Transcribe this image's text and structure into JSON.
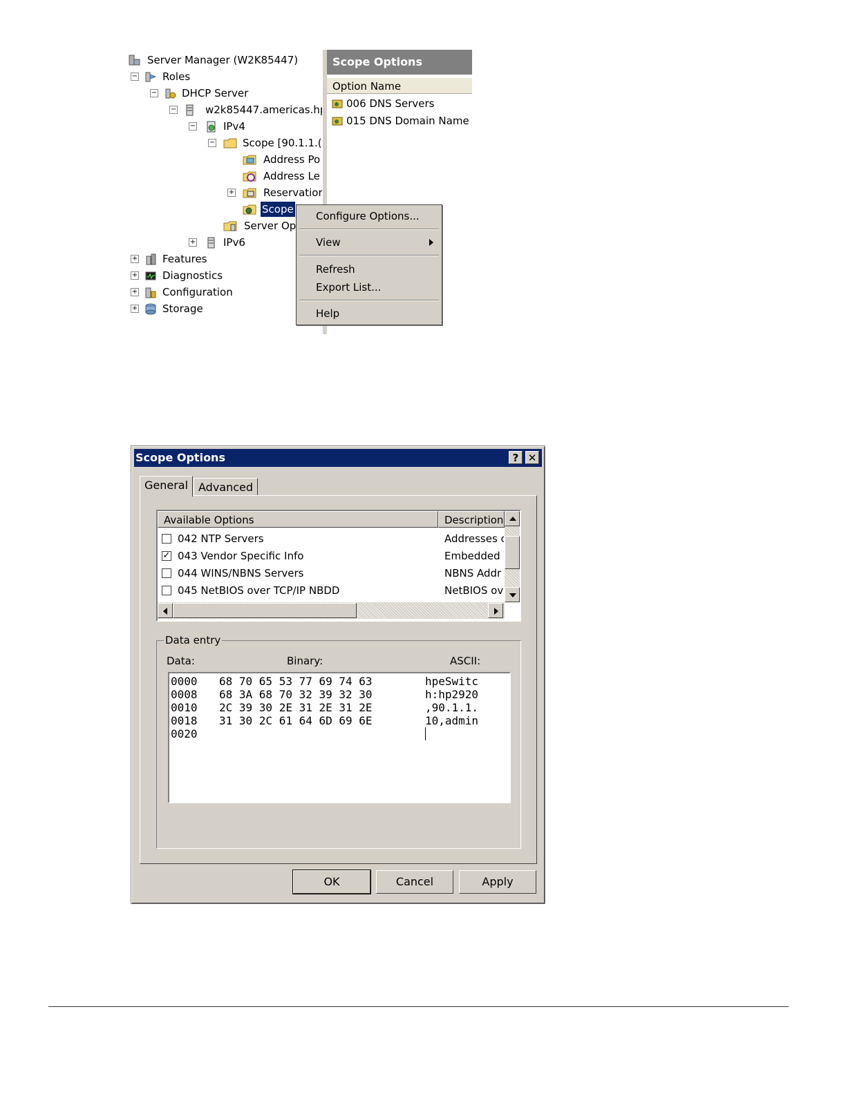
{
  "server_manager": {
    "tree": {
      "root": "Server Manager (W2K85447)",
      "roles": "Roles",
      "dhcp_server": "DHCP Server",
      "host": "w2k85447.americas.hp",
      "ipv4": "IPv4",
      "scope": "Scope [90.1.1.(",
      "address_pool": "Address Po",
      "address_leases": "Address Le",
      "reservations": "Reservatior",
      "scope_options": "Scope",
      "server_options": "Server Op",
      "ipv6": "IPv6",
      "features": "Features",
      "diagnostics": "Diagnostics",
      "configuration": "Configuration",
      "storage": "Storage",
      "expand_symbol": "+",
      "collapse_symbol": "−"
    },
    "right_pane": {
      "title": "Scope Options",
      "column_header": "Option Name",
      "items": [
        "006 DNS Servers",
        "015 DNS Domain Name"
      ]
    },
    "context_menu": {
      "items": {
        "configure": "Configure Options...",
        "view": "View",
        "refresh": "Refresh",
        "export": "Export List...",
        "help": "Help"
      }
    }
  },
  "dialog": {
    "title": "Scope Options",
    "help_button": "?",
    "close_button": "✕",
    "tabs": {
      "general": "General",
      "advanced": "Advanced"
    },
    "active_tab": "General",
    "options_list": {
      "headers": {
        "name": "Available Options",
        "description": "Description"
      },
      "rows": [
        {
          "checked": false,
          "name": "042 NTP Servers",
          "description": "Addresses c"
        },
        {
          "checked": true,
          "name": "043 Vendor Specific Info",
          "description": "Embedded v"
        },
        {
          "checked": false,
          "name": "044 WINS/NBNS Servers",
          "description": "NBNS Addr"
        },
        {
          "checked": false,
          "name": "045 NetBIOS over TCP/IP NBDD",
          "description": "NetBIOS ov"
        }
      ]
    },
    "data_entry": {
      "legend": "Data entry",
      "data_label": "Data:",
      "binary_label": "Binary:",
      "ascii_label": "ASCII:",
      "rows": [
        {
          "offset": "0000",
          "hex": "68 70 65 53 77 69 74 63",
          "ascii": "hpeSwitc"
        },
        {
          "offset": "0008",
          "hex": "68 3A 68 70 32 39 32 30",
          "ascii": "h:hp2920"
        },
        {
          "offset": "0010",
          "hex": "2C 39 30 2E 31 2E 31 2E",
          "ascii": ",90.1.1."
        },
        {
          "offset": "0018",
          "hex": "31 30 2C 61 64 6D 69 6E",
          "ascii": "10,admin"
        },
        {
          "offset": "0020",
          "hex": "",
          "ascii": ""
        }
      ]
    },
    "buttons": {
      "ok": "OK",
      "cancel": "Cancel",
      "apply": "Apply"
    }
  },
  "colors": {
    "title_bar": "#0a246a",
    "face": "#d4d0c8",
    "selection": "#0a246a"
  }
}
